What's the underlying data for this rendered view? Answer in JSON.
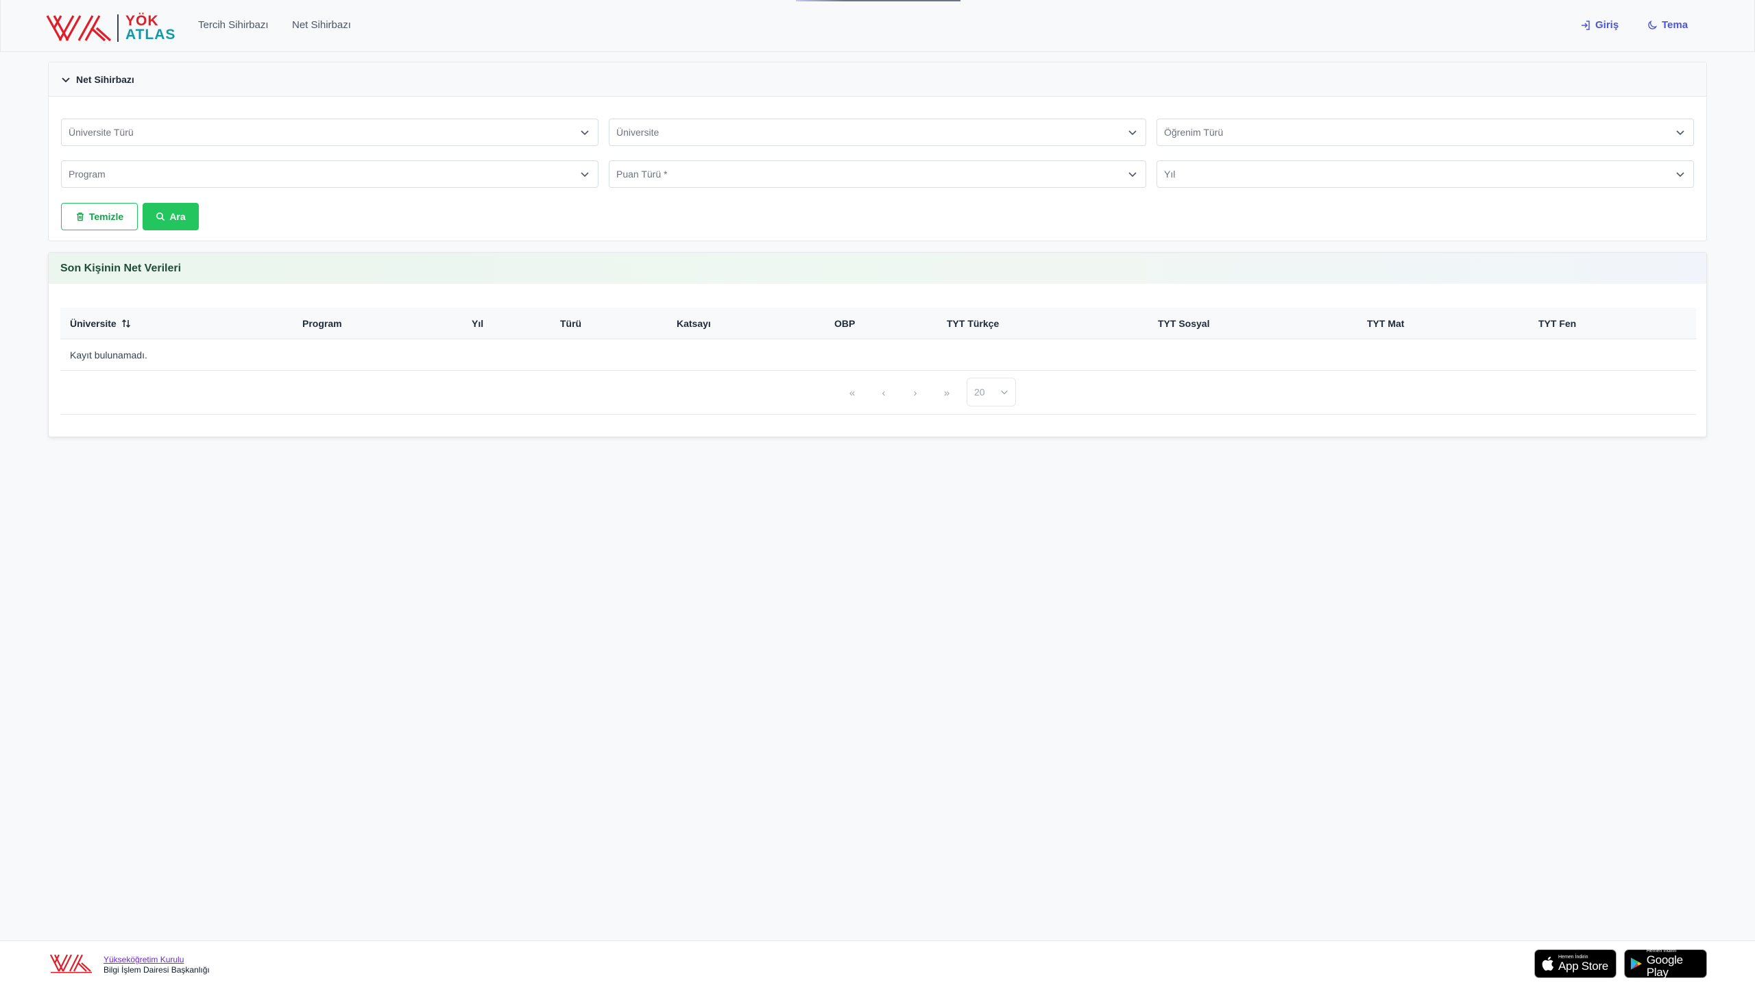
{
  "brand": {
    "line1": "YÖK",
    "line2": "ATLAS",
    "red": "#e11d28",
    "teal": "#0e9aa7"
  },
  "nav": {
    "links": [
      "Tercih Sihirbazı",
      "Net Sihirbazı"
    ],
    "login": "Giriş",
    "theme": "Tema"
  },
  "filter_panel": {
    "title": "Net Sihirbazı",
    "selects": {
      "university_type": "Üniversite Türü",
      "university": "Üniversite",
      "education_type": "Öğrenim Türü",
      "program": "Program",
      "score_type": "Puan Türü *",
      "year": "Yıl"
    },
    "clear_label": "Temizle",
    "search_label": "Ara",
    "accent": "#22c55e"
  },
  "results": {
    "title": "Son Kişinin Net Verileri",
    "columns": [
      "Üniversite",
      "Program",
      "Yıl",
      "Türü",
      "Katsayı",
      "OBP",
      "TYT Türkçe",
      "TYT Sosyal",
      "TYT Mat",
      "TYT Fen"
    ],
    "empty_message": "Kayıt bulunamadı.",
    "pager": {
      "first": "«",
      "prev": "‹",
      "next": "›",
      "last": "»",
      "page_size": "20"
    }
  },
  "footer": {
    "org_link": "Yükseköğretim Kurulu",
    "department": "Bilgi İşlem Dairesi Başkanlığı",
    "app_store": {
      "small": "Hemen İndirin",
      "big": "App Store"
    },
    "google_play": {
      "small": "Hemen İndirin",
      "big": "Google Play"
    }
  }
}
